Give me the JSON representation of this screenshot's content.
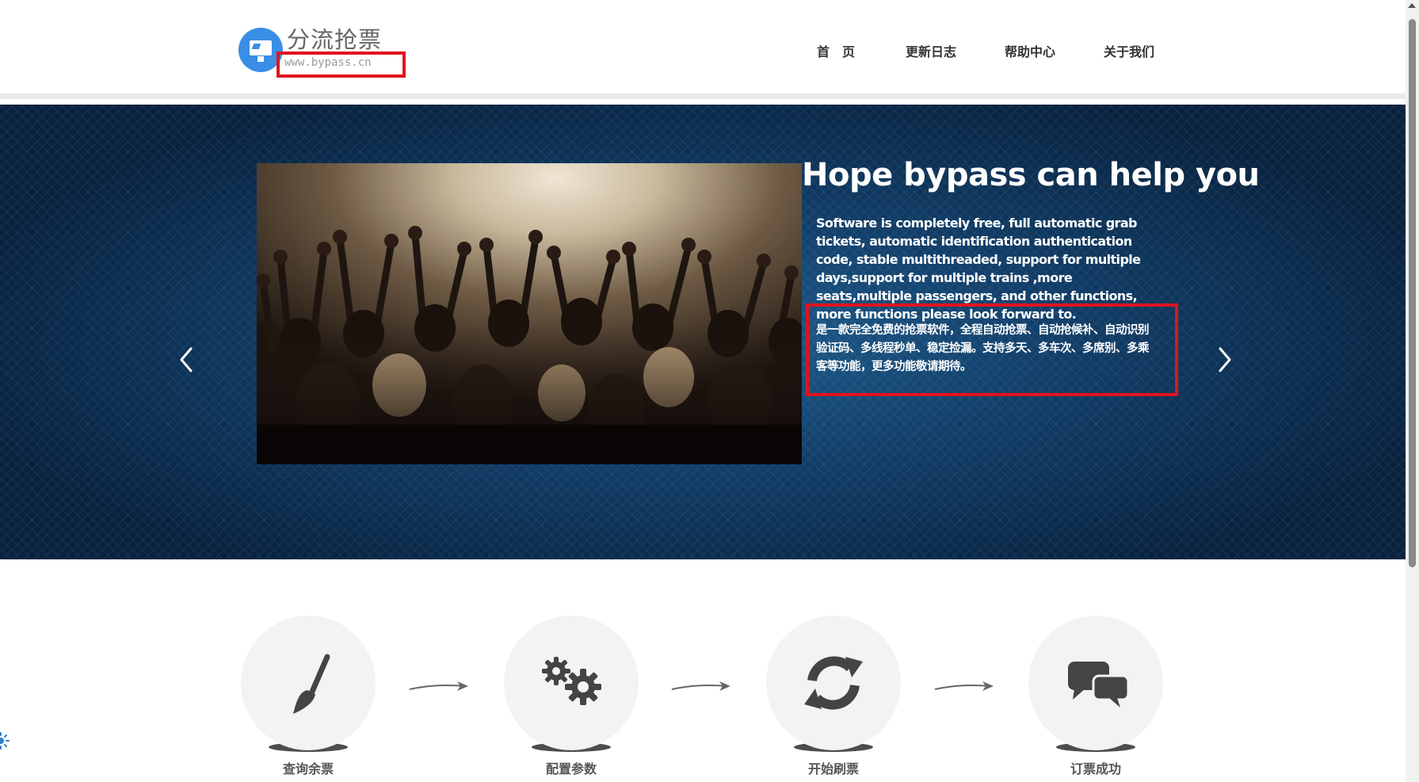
{
  "header": {
    "logo_title": "分流抢票",
    "logo_url": "www.bypass.cn",
    "nav": [
      "首　页",
      "更新日志",
      "帮助中心",
      "关于我们"
    ]
  },
  "hero": {
    "heading": "Hope bypass can help you",
    "description_en": "Software is completely free, full automatic grab tickets, automatic identification authentication code, stable multithreaded, support for multiple days,support for multiple trains ,more seats,multiple passengers, and other functions, more functions please look forward to.",
    "description_cn": "是一款完全免费的抢票软件，全程自动抢票、自动抢候补、自动识别验证码、多线程秒单、稳定捡漏。支持多天、多车次、多席别、多乘客等功能，更多功能敬请期待。"
  },
  "steps": [
    {
      "label": "查询余票",
      "icon": "paintbrush-icon"
    },
    {
      "label": "配置参数",
      "icon": "gears-icon"
    },
    {
      "label": "开始刷票",
      "icon": "refresh-icon"
    },
    {
      "label": "订票成功",
      "icon": "chat-bubbles-icon"
    }
  ],
  "colors": {
    "accent": "#3a8ee6",
    "highlight": "#e0141e",
    "banner": "#123f6a"
  }
}
